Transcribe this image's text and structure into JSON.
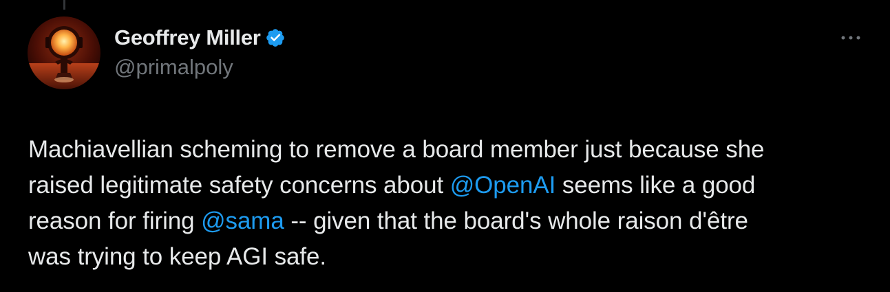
{
  "tweet": {
    "author": {
      "display_name": "Geoffrey Miller",
      "handle": "@primalpoly",
      "verified": true,
      "avatar_icon": "avatar-robot-image"
    },
    "more_icon": "more-horizontal-icon",
    "text": {
      "line1": "Machiavellian scheming to remove a board member just because she",
      "line2_before": "raised legitimate safety concerns about ",
      "line2_mention": "@OpenAI",
      "line2_after": " seems like a good",
      "line3_before": "reason for firing ",
      "line3_mention": "@sama",
      "line3_after": " -- given that the board's whole raison d'être",
      "line4": "was trying to keep AGI safe."
    }
  },
  "colors": {
    "background": "#000000",
    "text_primary": "#e7e9ea",
    "text_secondary": "#71767b",
    "link": "#1d9bf0",
    "verified": "#1d9bf0"
  }
}
